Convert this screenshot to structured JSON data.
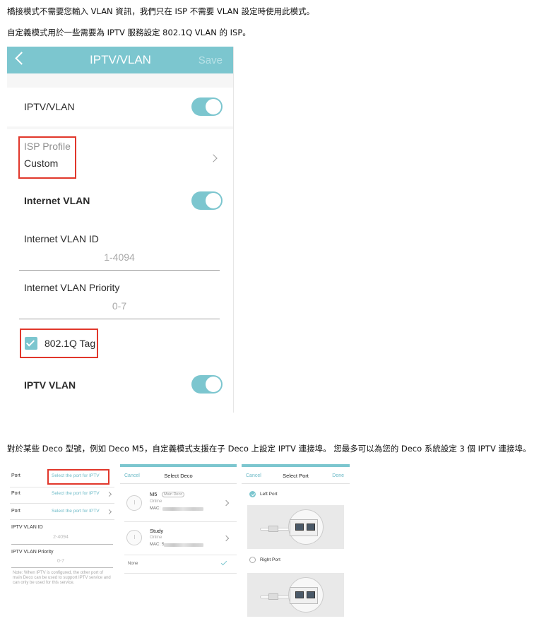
{
  "intro": {
    "line1": "橋接模式不需要您輸入 VLAN 資訊，我們只在 ISP 不需要 VLAN 設定時使用此模式。",
    "line2": "自定義模式用於一些需要為 IPTV 服務設定 802.1Q VLAN 的 ISP。"
  },
  "phone": {
    "header": {
      "title": "IPTV/VLAN",
      "save_label": "Save"
    },
    "iptv_vlan_label": "IPTV/VLAN",
    "iptv_vlan_enabled": true,
    "isp_profile": {
      "label": "ISP Profile",
      "value": "Custom"
    },
    "internet_vlan_label": "Internet VLAN",
    "internet_vlan_enabled": true,
    "internet_vlan_id": {
      "label": "Internet VLAN ID",
      "placeholder": "1-4094"
    },
    "internet_vlan_priority": {
      "label": "Internet VLAN Priority",
      "placeholder": "0-7"
    },
    "tag_8021q": {
      "label": "802.1Q Tag",
      "checked": true
    },
    "iptv_vlan_section_label": "IPTV VLAN",
    "iptv_vlan_section_enabled": true
  },
  "middle_paragraph": "對於某些 Deco 型號，例如 Deco M5，自定義模式支援在子 Deco 上設定 IPTV 連接埠。 您最多可以為您的 Deco 系統設定 3 個 IPTV 連接埠。",
  "port_screen": {
    "rows": [
      {
        "label": "Port",
        "link": "Select the port for IPTV"
      },
      {
        "label": "Port",
        "link": "Select the port for IPTV"
      },
      {
        "label": "Port",
        "link": "Select the port for IPTV"
      }
    ],
    "iptv_vlan_id": {
      "label": "IPTV VLAN ID",
      "placeholder": "2-4094"
    },
    "iptv_vlan_priority": {
      "label": "IPTV VLAN Priority",
      "placeholder": "0-7"
    },
    "note": "Note: When IPTV is configured, the other port of main Deco can be used to support IPTV service and can only be used for this service."
  },
  "select_deco": {
    "cancel_label": "Cancel",
    "title": "Select Deco",
    "items": [
      {
        "name": "M5",
        "tag": "Main Deco",
        "status": "Online",
        "mac_label": "MAC:"
      },
      {
        "name": "Study",
        "tag": "",
        "status": "Online",
        "mac_label": "MAC: S"
      }
    ],
    "none_label": "None"
  },
  "select_port": {
    "cancel_label": "Cancel",
    "title": "Select Port",
    "done_label": "Done",
    "options": [
      {
        "label": "Left Port",
        "selected": true
      },
      {
        "label": "Right Port",
        "selected": false
      }
    ]
  },
  "colors": {
    "accent": "#7cc6cf",
    "highlight_red": "#e1372b"
  }
}
